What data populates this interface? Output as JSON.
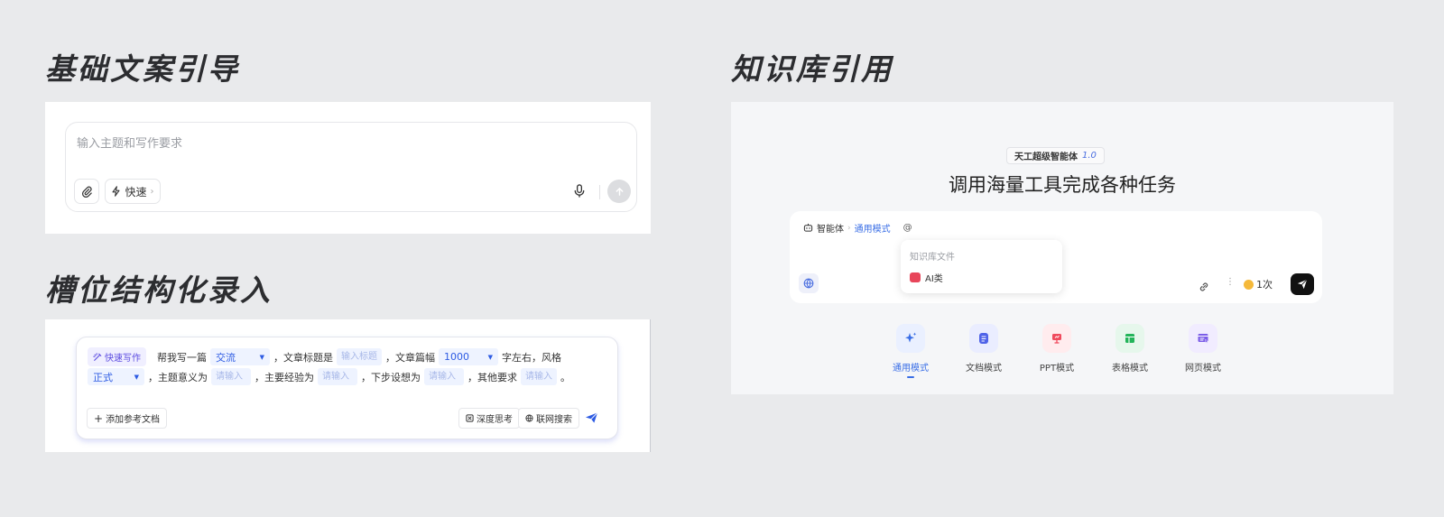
{
  "sections": {
    "basic_copy_guide": "基础文案引导",
    "slot_structured_input": "槽位结构化录入",
    "knowledge_base_ref": "知识库引用"
  },
  "basic_input": {
    "placeholder": "输入主题和写作要求",
    "quick_label": "快速"
  },
  "slot_form": {
    "tag": "快速写作",
    "line1": {
      "t1": "帮我写一篇",
      "type_value": "交流",
      "t2": "，文章标题是",
      "title_placeholder": "输入标题",
      "t3": "，文章篇幅",
      "length_value": "1000",
      "t4": "字左右，风格"
    },
    "line2": {
      "style_value": "正式",
      "t1": "，主题意义为",
      "ph1": "请输入",
      "t2": "，主要经验为",
      "ph2": "请输入",
      "t3": "，下步设想为",
      "ph3": "请输入",
      "t4": "，其他要求",
      "ph4": "请输入",
      "t5": "。"
    },
    "add_ref_label": "添加参考文档",
    "deep_think_label": "深度思考",
    "web_search_label": "联网搜索"
  },
  "kb": {
    "badge_name": "天工超级智能体",
    "badge_version": "1.0",
    "headline": "调用海量工具完成各种任务",
    "crumb_agent": "智能体",
    "crumb_mode": "通用模式",
    "at_symbol": "@",
    "dropdown_header": "知识库文件",
    "dropdown_item": "AI类",
    "count": "1次",
    "modes": [
      {
        "label": "通用模式"
      },
      {
        "label": "文档模式"
      },
      {
        "label": "PPT模式"
      },
      {
        "label": "表格模式"
      },
      {
        "label": "网页模式"
      }
    ]
  },
  "colors": {
    "accent": "#3b6fe6",
    "quick_tag": "#5b4be0",
    "ppt": "#f04a5d",
    "table": "#23b45a",
    "web": "#7b5de8"
  }
}
